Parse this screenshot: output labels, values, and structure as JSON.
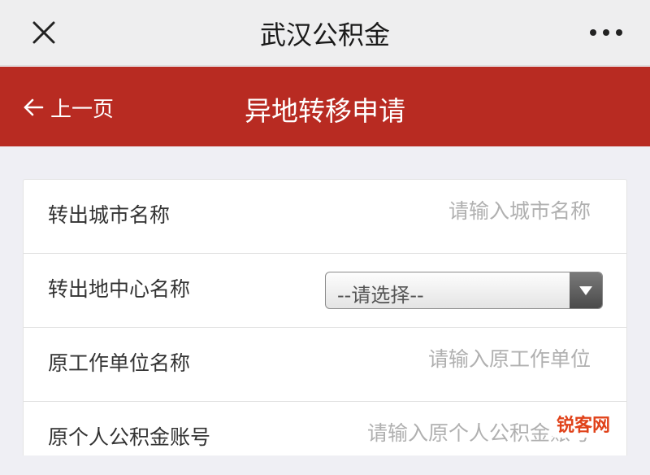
{
  "app": {
    "title": "武汉公积金"
  },
  "navbar": {
    "back_label": "上一页",
    "page_title": "异地转移申请",
    "color": "#b82b22"
  },
  "form": {
    "rows": [
      {
        "label": "转出城市名称",
        "type": "text",
        "placeholder": "请输入城市名称"
      },
      {
        "label": "转出地中心名称",
        "type": "select",
        "selected": "--请选择--"
      },
      {
        "label": "原工作单位名称",
        "type": "text",
        "placeholder": "请输入原工作单位"
      },
      {
        "label": "原个人公积金账号",
        "type": "text",
        "placeholder": "请输入原个人公积金账号"
      }
    ]
  },
  "icons": {
    "close": "close-icon",
    "more": "more-icon",
    "back": "arrow-left-icon",
    "dropdown": "chevron-down-icon"
  },
  "watermark": {
    "text": "锐客网",
    "color": "#e0421a"
  }
}
